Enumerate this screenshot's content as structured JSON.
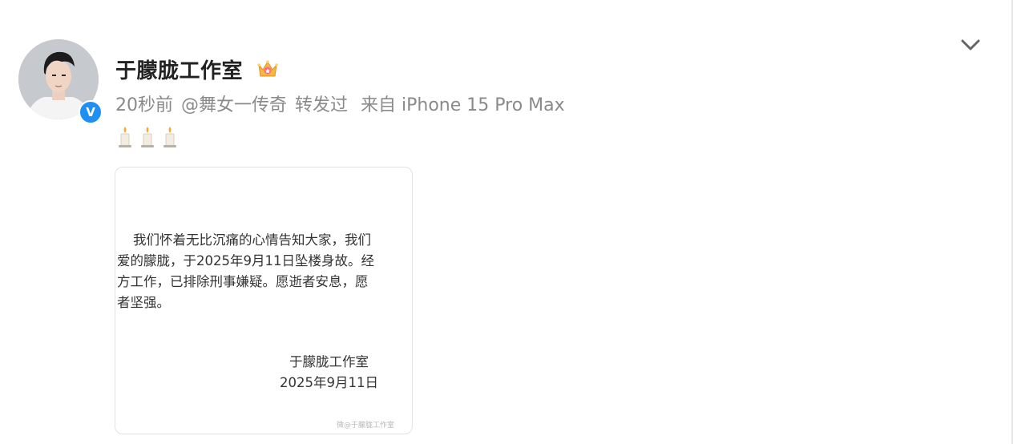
{
  "post": {
    "author_name": "于朦胧工作室",
    "meta": {
      "time": "20秒前",
      "via_user": "@舞女一传奇",
      "action": "转发过",
      "source": "来自 iPhone 15 Pro Max"
    },
    "candle_emojis": [
      "candle-icon",
      "candle-icon",
      "candle-icon"
    ],
    "image": {
      "lines": [
        "我们怀着无比沉痛的心情告知大家，我们",
        "爱的朦胧，于2025年9月11日坠楼身故。经",
        "方工作，已排除刑事嫌疑。愿逝者安息，愿",
        "者坚强。"
      ],
      "signature_name": "于朦胧工作室",
      "signature_date": "2025年9月11日",
      "watermark": "微@于朦胧工作室"
    }
  },
  "icons": {
    "verified": "verified-badge-icon",
    "crown": "crown-icon",
    "dropdown": "chevron-down-icon"
  },
  "colors": {
    "verified_blue": "#1e90f5",
    "meta_gray": "#8a8a8a",
    "name_dark": "#222222"
  }
}
